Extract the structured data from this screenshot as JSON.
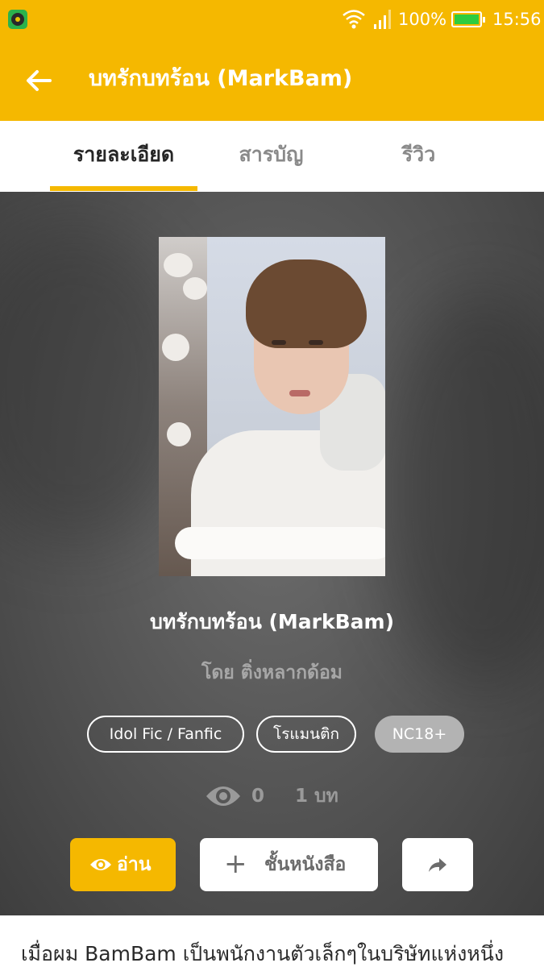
{
  "status_bar": {
    "battery": "100%",
    "time": "15:56"
  },
  "app_bar": {
    "title": "บทรักบทร้อน (MarkBam)"
  },
  "tabs": [
    {
      "label": "รายละเอียด",
      "active": true
    },
    {
      "label": "สารบัญ",
      "active": false
    },
    {
      "label": "รีวิว",
      "active": false
    }
  ],
  "book": {
    "title": "บทรักบทร้อน (MarkBam)",
    "author": "โดย ติ่งหลากด้อม",
    "tags": [
      "Idol Fic / Fanfic",
      "โรแมนติก",
      "NC18+"
    ],
    "views": "0",
    "chapters": "1 บท"
  },
  "actions": {
    "read_label": "อ่าน",
    "shelf_label": "ชั้นหนังสือ"
  },
  "synopsis": "เมื่อผม BamBam เป็นพนักงานตัวเล็กๆในบริษัทแห่งหนึ่ง",
  "colors": {
    "accent": "#f5b800",
    "tag_filled": "#b3b3b3"
  }
}
